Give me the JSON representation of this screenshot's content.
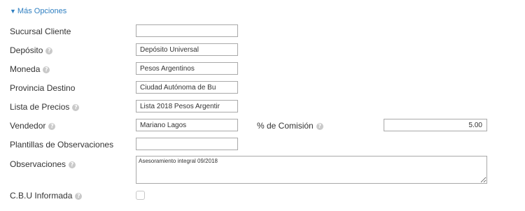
{
  "more_options": {
    "label": "Más Opciones",
    "arrow_icon": "triangle-down-icon"
  },
  "fields": {
    "sucursal_cliente": {
      "label": "Sucursal Cliente",
      "value": ""
    },
    "deposito": {
      "label": "Depósito",
      "value": "Depósito Universal"
    },
    "moneda": {
      "label": "Moneda",
      "value": "Pesos Argentinos"
    },
    "provincia_destino": {
      "label": "Provincia Destino",
      "value": "Ciudad Autónoma de Bu"
    },
    "lista_precios": {
      "label": "Lista de Precios",
      "value": "Lista 2018 Pesos Argentir"
    },
    "vendedor": {
      "label": "Vendedor",
      "value": "Mariano Lagos"
    },
    "comision": {
      "label": "% de Comisión",
      "value": "5.00"
    },
    "plantillas_observaciones": {
      "label": "Plantillas de Observaciones",
      "value": ""
    },
    "observaciones": {
      "label": "Observaciones",
      "value": "Asesoramiento integral 09/2018"
    },
    "cbu_informada": {
      "label": "C.B.U Informada",
      "checked": false
    }
  },
  "help_glyph": "?"
}
